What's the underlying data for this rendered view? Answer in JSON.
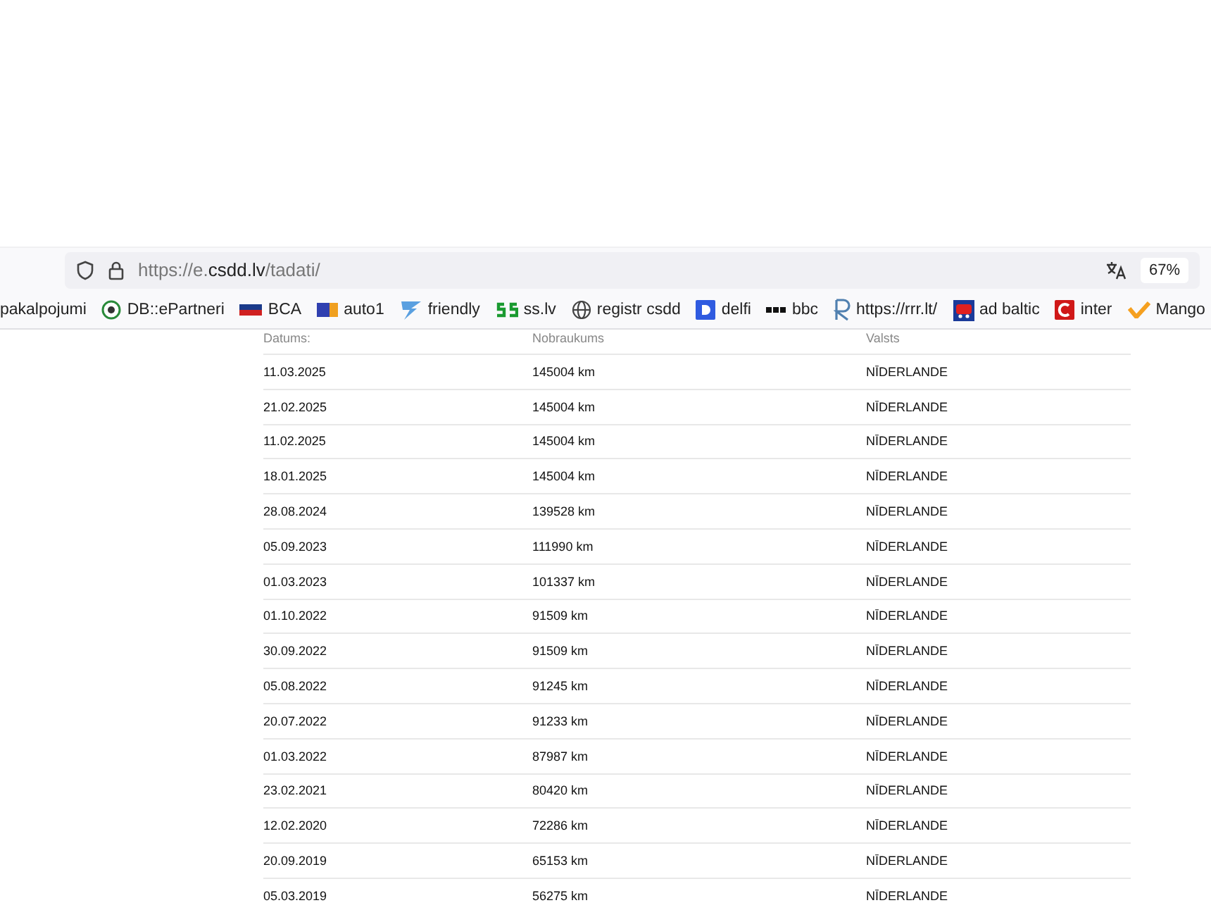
{
  "address_bar": {
    "url_prefix": "https://e.",
    "url_domain": "csdd.lv",
    "url_path": "/tadati/",
    "zoom": "67%"
  },
  "bookmarks": [
    {
      "label": "pakalpojumi"
    },
    {
      "label": "DB::ePartneri"
    },
    {
      "label": "BCA"
    },
    {
      "label": "auto1"
    },
    {
      "label": "friendly"
    },
    {
      "label": "ss.lv"
    },
    {
      "label": "registr csdd"
    },
    {
      "label": "delfi"
    },
    {
      "label": "bbc"
    },
    {
      "label": "https://rrr.lt/"
    },
    {
      "label": "ad baltic"
    },
    {
      "label": "inter"
    },
    {
      "label": "Mango"
    }
  ],
  "table": {
    "columns": [
      "Datums:",
      "Nobraukums",
      "Valsts"
    ],
    "rows": [
      [
        "11.03.2025",
        "145004 km",
        "NĪDERLANDE"
      ],
      [
        "21.02.2025",
        "145004 km",
        "NĪDERLANDE"
      ],
      [
        "11.02.2025",
        "145004 km",
        "NĪDERLANDE"
      ],
      [
        "18.01.2025",
        "145004 km",
        "NĪDERLANDE"
      ],
      [
        "28.08.2024",
        "139528 km",
        "NĪDERLANDE"
      ],
      [
        "05.09.2023",
        "111990 km",
        "NĪDERLANDE"
      ],
      [
        "01.03.2023",
        "101337 km",
        "NĪDERLANDE"
      ],
      [
        "01.10.2022",
        "91509 km",
        "NĪDERLANDE"
      ],
      [
        "30.09.2022",
        "91509 km",
        "NĪDERLANDE"
      ],
      [
        "05.08.2022",
        "91245 km",
        "NĪDERLANDE"
      ],
      [
        "20.07.2022",
        "91233 km",
        "NĪDERLANDE"
      ],
      [
        "01.03.2022",
        "87987 km",
        "NĪDERLANDE"
      ],
      [
        "23.02.2021",
        "80420 km",
        "NĪDERLANDE"
      ],
      [
        "12.02.2020",
        "72286 km",
        "NĪDERLANDE"
      ],
      [
        "20.09.2019",
        "65153 km",
        "NĪDERLANDE"
      ],
      [
        "05.03.2019",
        "56275 km",
        "NĪDERLANDE"
      ]
    ]
  }
}
